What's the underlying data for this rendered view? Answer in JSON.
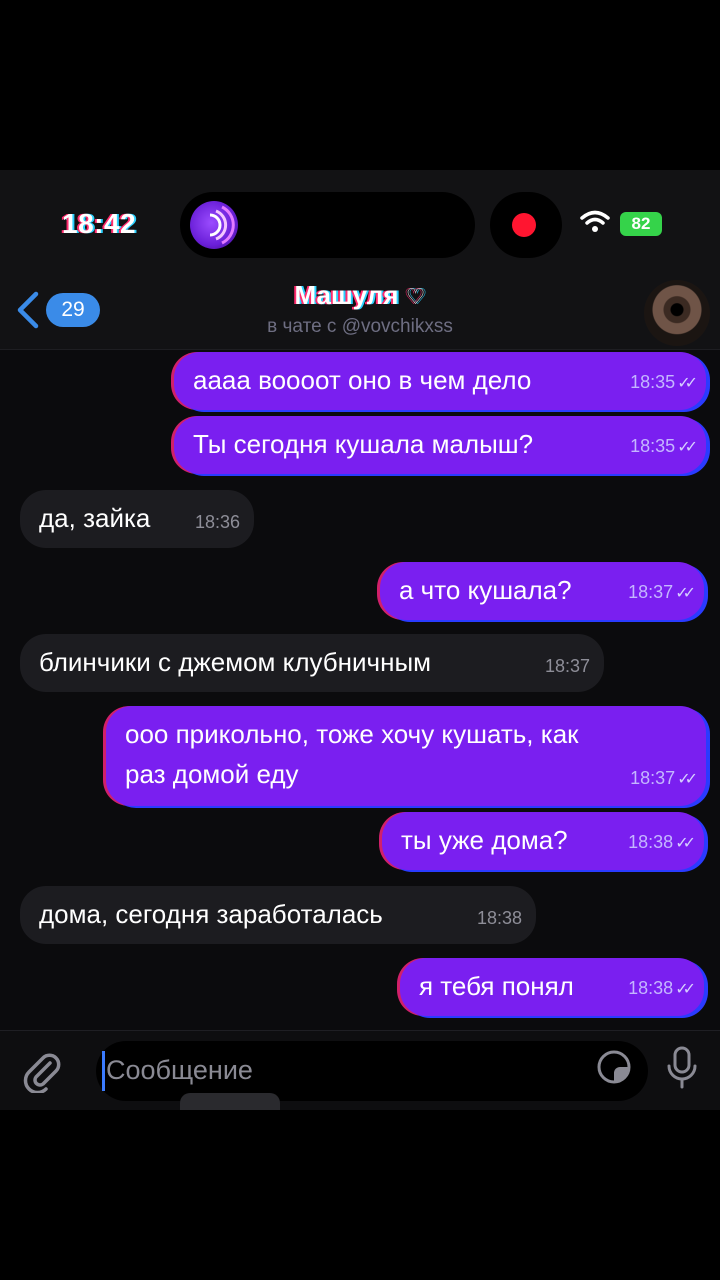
{
  "status_bar": {
    "time": "18:42",
    "battery": "82",
    "icons": [
      "app-activity-icon",
      "recording-dot-icon",
      "wifi-icon",
      "battery-icon"
    ]
  },
  "header": {
    "back_count": "29",
    "title": "Машуля",
    "subtitle": "в чате с @vovchikxss"
  },
  "messages": [
    {
      "dir": "out",
      "text": "аааа воооот оно в чем дело",
      "time": "18:35"
    },
    {
      "dir": "out",
      "text": "Ты сегодня кушала малыш?",
      "time": "18:35"
    },
    {
      "dir": "in",
      "text": "да, зайка",
      "time": "18:36"
    },
    {
      "dir": "out",
      "text": "а что кушала?",
      "time": "18:37"
    },
    {
      "dir": "in",
      "text": "блинчики с джемом клубничным",
      "time": "18:37"
    },
    {
      "dir": "out",
      "text": "ооо прикольно, тоже хочу кушать, как",
      "text2": "раз домой еду",
      "time": "18:37"
    },
    {
      "dir": "out",
      "text": "ты уже дома?",
      "time": "18:38"
    },
    {
      "dir": "in",
      "text": "дома, сегодня заработалась",
      "time": "18:38"
    },
    {
      "dir": "out",
      "text": "я тебя понял",
      "time": "18:38"
    }
  ],
  "composer": {
    "placeholder": "Сообщение"
  },
  "colors": {
    "outgoing_bubble": "#7a1ff0",
    "incoming_bubble": "#1c1c20",
    "badge": "#3a8be8",
    "battery": "#35d34a",
    "record": "#ff1530"
  }
}
